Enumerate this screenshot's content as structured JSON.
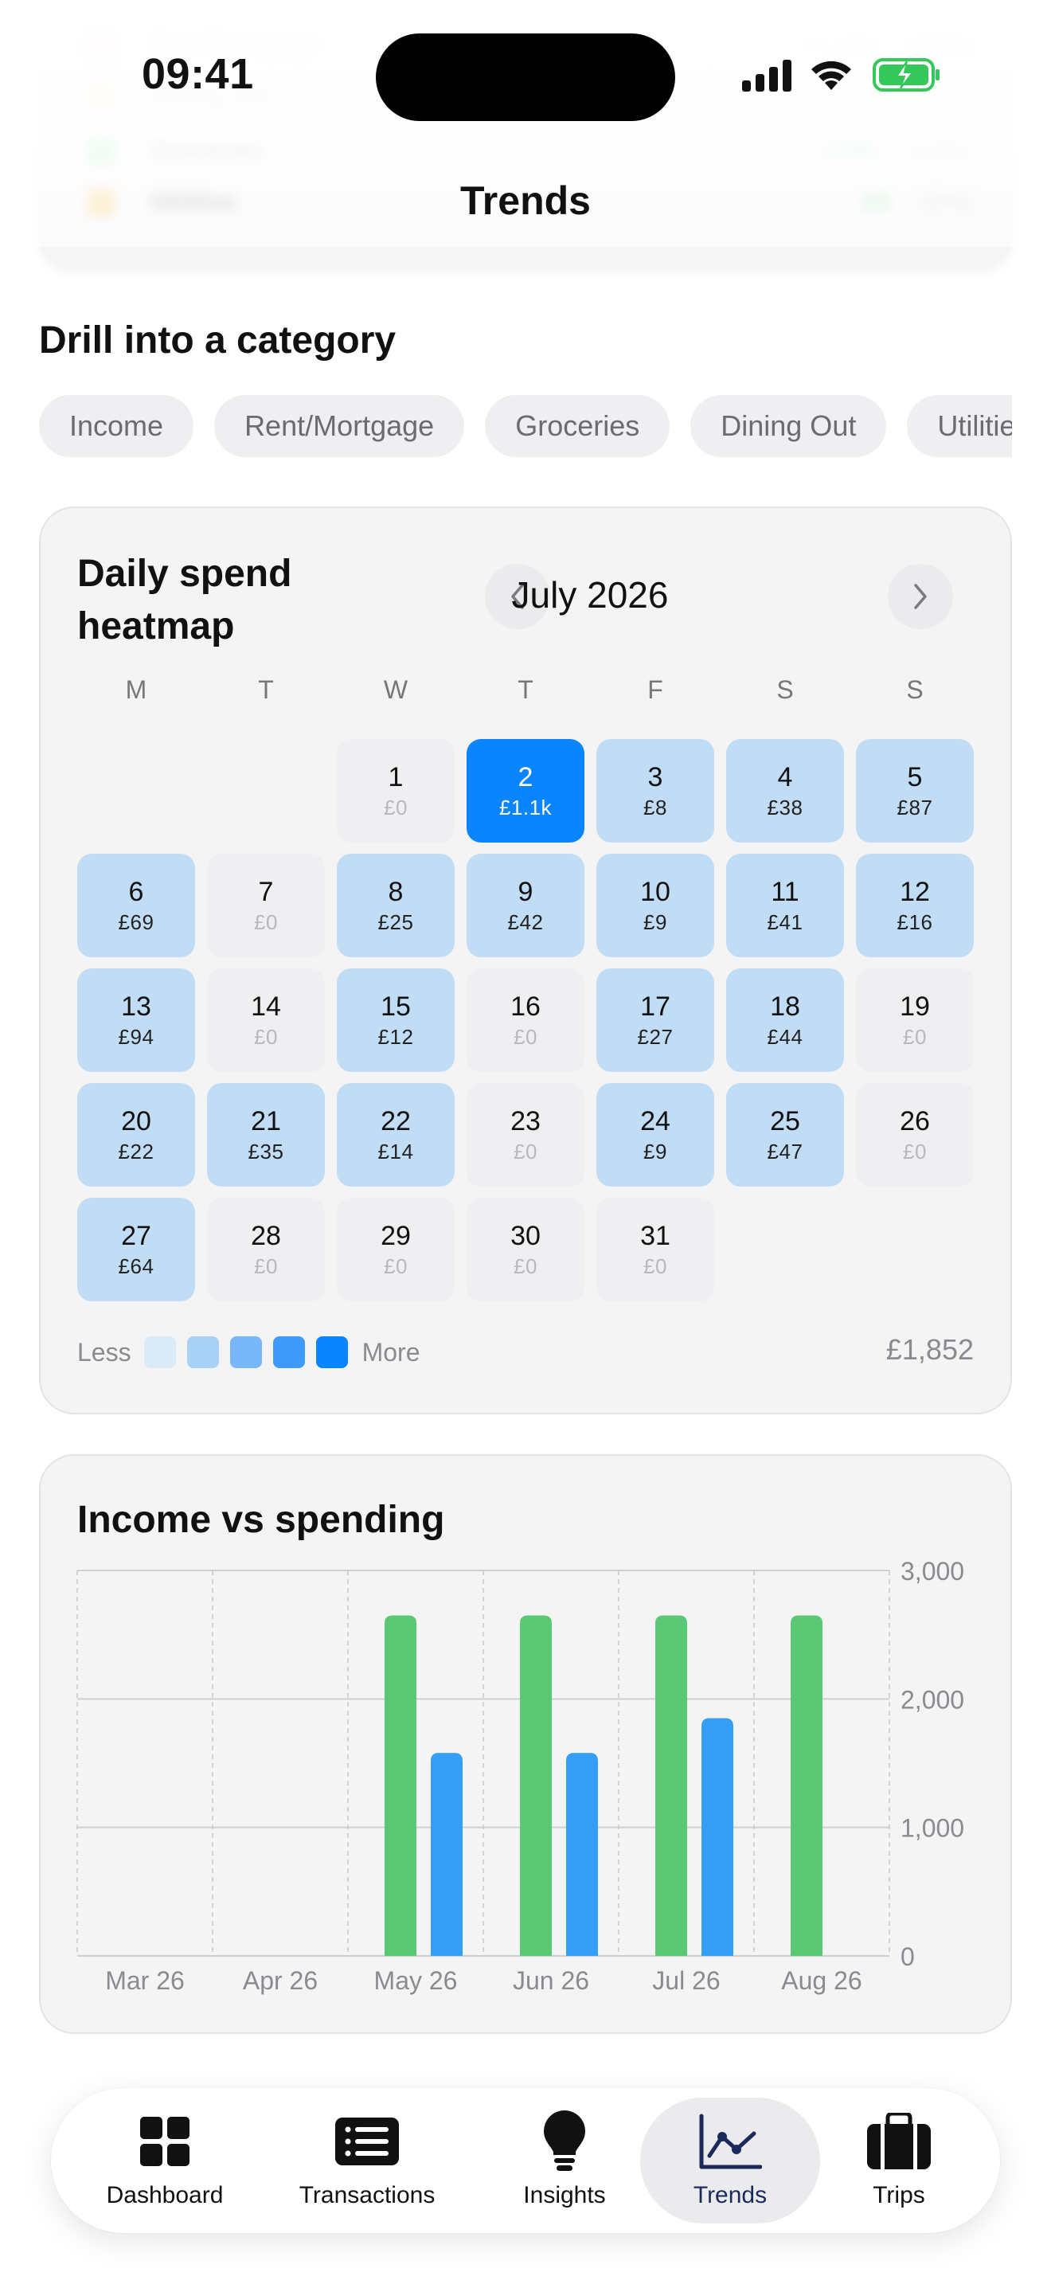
{
  "status_bar": {
    "time": "09:41"
  },
  "nav": {
    "title": "Trends"
  },
  "drill": {
    "title": "Drill into a category",
    "chips": [
      "Income",
      "Rent/Mortgage",
      "Groceries",
      "Dining Out",
      "Utilities"
    ]
  },
  "heatmap": {
    "title": "Daily spend heatmap",
    "month": "July 2026",
    "weekdays": [
      "M",
      "T",
      "W",
      "T",
      "F",
      "S",
      "S"
    ],
    "days": [
      {
        "day": "1",
        "amount": "£0",
        "level": 0
      },
      {
        "day": "2",
        "amount": "£1.1k",
        "level": 4
      },
      {
        "day": "3",
        "amount": "£8",
        "level": 1
      },
      {
        "day": "4",
        "amount": "£38",
        "level": 1
      },
      {
        "day": "5",
        "amount": "£87",
        "level": 1
      },
      {
        "day": "6",
        "amount": "£69",
        "level": 1
      },
      {
        "day": "7",
        "amount": "£0",
        "level": 0
      },
      {
        "day": "8",
        "amount": "£25",
        "level": 1
      },
      {
        "day": "9",
        "amount": "£42",
        "level": 1
      },
      {
        "day": "10",
        "amount": "£9",
        "level": 1
      },
      {
        "day": "11",
        "amount": "£41",
        "level": 1
      },
      {
        "day": "12",
        "amount": "£16",
        "level": 1
      },
      {
        "day": "13",
        "amount": "£94",
        "level": 1
      },
      {
        "day": "14",
        "amount": "£0",
        "level": 0
      },
      {
        "day": "15",
        "amount": "£12",
        "level": 1
      },
      {
        "day": "16",
        "amount": "£0",
        "level": 0
      },
      {
        "day": "17",
        "amount": "£27",
        "level": 1
      },
      {
        "day": "18",
        "amount": "£44",
        "level": 1
      },
      {
        "day": "19",
        "amount": "£0",
        "level": 0
      },
      {
        "day": "20",
        "amount": "£22",
        "level": 1
      },
      {
        "day": "21",
        "amount": "£35",
        "level": 1
      },
      {
        "day": "22",
        "amount": "£14",
        "level": 1
      },
      {
        "day": "23",
        "amount": "£0",
        "level": 0
      },
      {
        "day": "24",
        "amount": "£9",
        "level": 1
      },
      {
        "day": "25",
        "amount": "£47",
        "level": 1
      },
      {
        "day": "26",
        "amount": "£0",
        "level": 0
      },
      {
        "day": "27",
        "amount": "£64",
        "level": 1
      },
      {
        "day": "28",
        "amount": "£0",
        "level": 0
      },
      {
        "day": "29",
        "amount": "£0",
        "level": 0
      },
      {
        "day": "30",
        "amount": "£0",
        "level": 0
      },
      {
        "day": "31",
        "amount": "£0",
        "level": 0
      }
    ],
    "legend_less": "Less",
    "legend_more": "More",
    "legend_colors": [
      "#dcebf8",
      "#a9d1f7",
      "#79b8f8",
      "#3f9bfb",
      "#0a84ff"
    ],
    "total": "£1,852"
  },
  "chart_data": {
    "type": "bar",
    "title": "Income vs spending",
    "categories": [
      "Mar 26",
      "Apr 26",
      "May 26",
      "Jun 26",
      "Jul 26",
      "Aug 26"
    ],
    "series": [
      {
        "color": "#5ac874",
        "values": [
          0,
          0,
          2650,
          2650,
          2650,
          2650
        ]
      },
      {
        "color": "#359ff8",
        "values": [
          0,
          0,
          1580,
          1580,
          1850,
          0
        ]
      }
    ],
    "ylim": [
      0,
      3000
    ],
    "yticks": [
      "3,000",
      "2,000",
      "1,000",
      "0"
    ],
    "ytick_values": [
      3000,
      2000,
      1000,
      0
    ],
    "grid": true
  },
  "tabbar": {
    "tabs": [
      {
        "label": "Dashboard",
        "icon": "grid-icon"
      },
      {
        "label": "Transactions",
        "icon": "list-icon"
      },
      {
        "label": "Insights",
        "icon": "lightbulb-icon"
      },
      {
        "label": "Trends",
        "icon": "chart-line-icon"
      },
      {
        "label": "Trips",
        "icon": "suitcase-icon"
      }
    ],
    "active": "Trends"
  }
}
